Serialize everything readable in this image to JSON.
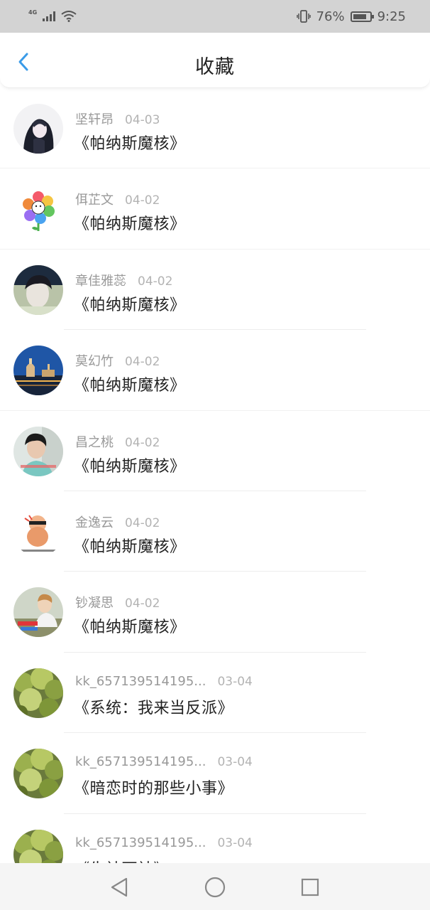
{
  "status_bar": {
    "network": "4G",
    "battery_percent": "76%",
    "time": "9:25",
    "icons": [
      "signal-icon",
      "wifi-icon",
      "vibrate-icon",
      "battery-icon"
    ]
  },
  "header": {
    "title": "收藏",
    "back_icon": "chevron-left-icon",
    "accent_color": "#3a9be8"
  },
  "favorites": [
    {
      "user": "坚轩昂",
      "date": "04-03",
      "book": "《帕纳斯魔核》",
      "avatar": "anime-girl-avatar"
    },
    {
      "user": "佴芷文",
      "date": "04-02",
      "book": "《帕纳斯魔核》",
      "avatar": "flower-avatar"
    },
    {
      "user": "章佳雅蕊",
      "date": "04-02",
      "book": "《帕纳斯魔核》",
      "avatar": "boy-portrait-avatar"
    },
    {
      "user": "莫幻竹",
      "date": "04-02",
      "book": "《帕纳斯魔核》",
      "avatar": "city-night-avatar"
    },
    {
      "user": "昌之桃",
      "date": "04-02",
      "book": "《帕纳斯魔核》",
      "avatar": "boy-photo-avatar"
    },
    {
      "user": "金逸云",
      "date": "04-02",
      "book": "《帕纳斯魔核》",
      "avatar": "meme-avatar"
    },
    {
      "user": "钞凝思",
      "date": "04-02",
      "book": "《帕纳斯魔核》",
      "avatar": "meme-photo-avatar"
    },
    {
      "user": "kk_657139514195...",
      "date": "03-04",
      "book": "《系统：我来当反派》",
      "avatar": "tree-avatar"
    },
    {
      "user": "kk_657139514195...",
      "date": "03-04",
      "book": "《暗恋时的那些小事》",
      "avatar": "tree-avatar"
    },
    {
      "user": "kk_657139514195...",
      "date": "03-04",
      "book": "《生神死神》",
      "avatar": "tree-avatar"
    }
  ],
  "nav_bar": {
    "buttons": [
      "back-triangle-icon",
      "home-circle-icon",
      "recents-square-icon"
    ]
  }
}
